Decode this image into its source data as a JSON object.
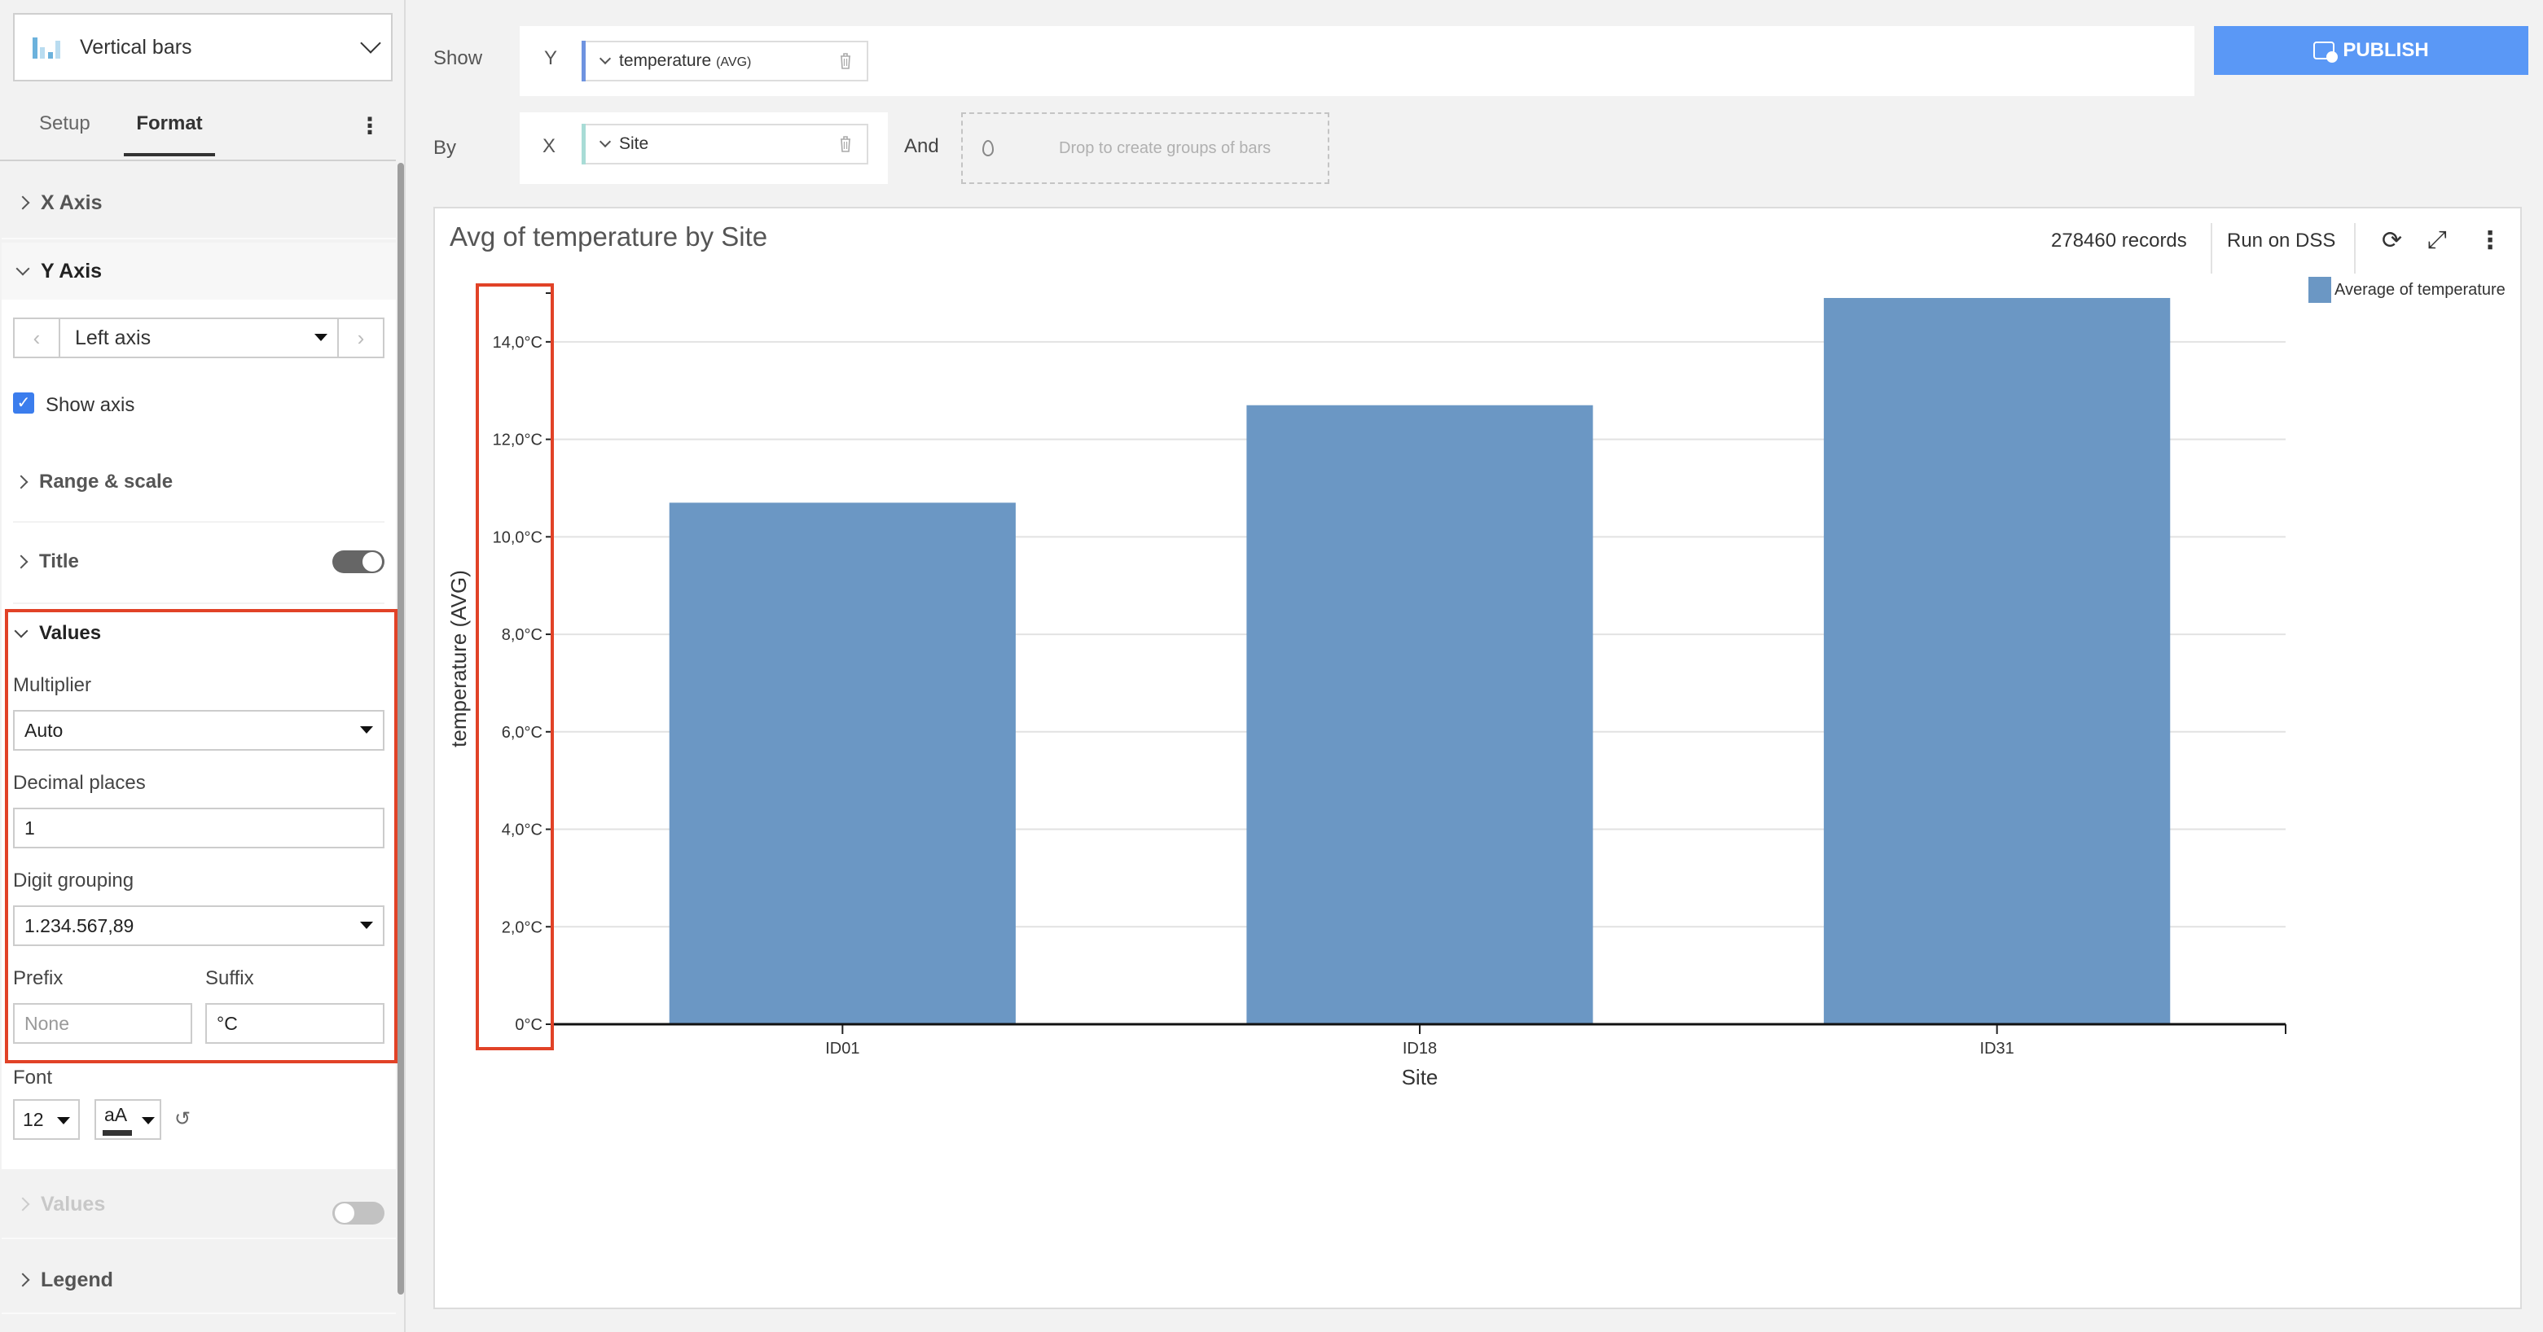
{
  "left_panel": {
    "chart_type": {
      "label": "Vertical bars",
      "icon": "vertical-bars-icon"
    },
    "tabs": [
      {
        "label": "Setup",
        "active": false
      },
      {
        "label": "Format",
        "active": true
      }
    ],
    "tabs_menu_icon": "⋮",
    "sections": {
      "x_axis": {
        "label": "X Axis",
        "expanded": false
      },
      "y_axis": {
        "label": "Y Axis",
        "expanded": true,
        "axis_selector": {
          "value": "Left axis",
          "prev": "‹",
          "next": "›"
        },
        "show_axis": {
          "label": "Show axis",
          "checked": true
        },
        "range_scale": {
          "label": "Range & scale",
          "expanded": false
        },
        "title": {
          "label": "Title",
          "toggle_on": true
        },
        "values": {
          "label": "Values",
          "expanded": true,
          "multiplier": {
            "label": "Multiplier",
            "value": "Auto"
          },
          "decimal_places": {
            "label": "Decimal places",
            "value": "1"
          },
          "digit_grouping": {
            "label": "Digit grouping",
            "value": "1.234.567,89"
          },
          "prefix": {
            "label": "Prefix",
            "value": "",
            "placeholder": "None"
          },
          "suffix": {
            "label": "Suffix",
            "value": "°C"
          }
        },
        "font": {
          "label": "Font",
          "size": "12",
          "style_label": "aA",
          "reset_icon": "↺"
        }
      },
      "values": {
        "label": "Values",
        "toggle_on": false,
        "disabled": true
      },
      "legend": {
        "label": "Legend",
        "expanded": false
      }
    }
  },
  "config": {
    "show_label": "Show",
    "by_label": "By",
    "and_label": "And",
    "y_letter": "Y",
    "x_letter": "X",
    "y_measure": {
      "name": "temperature",
      "agg": "(AVG)",
      "color": "#6e93e0"
    },
    "x_dimension": {
      "name": "Site",
      "color": "#a8dcd6"
    },
    "dropzone_text": "Drop to create groups of bars",
    "publish_label": "PUBLISH"
  },
  "card": {
    "title": "Avg of temperature by Site",
    "records": "278460 records",
    "run_label": "Run on DSS",
    "refresh_icon": "⟳",
    "expand_icon": "⤢",
    "menu_icon": "⋮"
  },
  "chart_data": {
    "type": "bar",
    "title": "Avg of temperature by Site",
    "xlabel": "Site",
    "ylabel": "temperature (AVG)",
    "categories": [
      "ID01",
      "ID18",
      "ID31"
    ],
    "series": [
      {
        "name": "Average of temperature",
        "values": [
          10.7,
          12.7,
          14.9
        ],
        "color": "#6b97c4"
      }
    ],
    "ylim": [
      0,
      15
    ],
    "yticks": [
      0,
      2,
      4,
      6,
      8,
      10,
      12,
      14
    ],
    "ytick_labels": [
      "0°C",
      "2,0°C",
      "4,0°C",
      "6,0°C",
      "8,0°C",
      "10,0°C",
      "12,0°C",
      "14,0°C"
    ],
    "grid": true,
    "legend_position": "top-right",
    "highlighted_region": "y-axis tick labels"
  }
}
